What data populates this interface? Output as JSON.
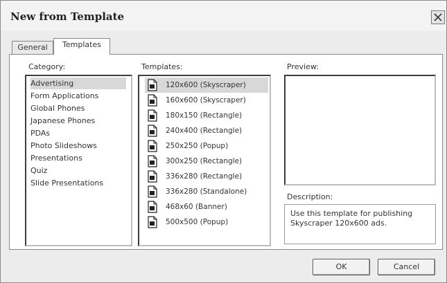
{
  "window": {
    "title": "New from Template"
  },
  "tabs": [
    {
      "label": "General",
      "active": false
    },
    {
      "label": "Templates",
      "active": true
    }
  ],
  "category": {
    "label": "Category:",
    "items": [
      {
        "label": "Advertising",
        "selected": true
      },
      {
        "label": "Form Applications",
        "selected": false
      },
      {
        "label": "Global Phones",
        "selected": false
      },
      {
        "label": "Japanese Phones",
        "selected": false
      },
      {
        "label": "PDAs",
        "selected": false
      },
      {
        "label": "Photo Slideshows",
        "selected": false
      },
      {
        "label": "Presentations",
        "selected": false
      },
      {
        "label": "Quiz",
        "selected": false
      },
      {
        "label": "Slide Presentations",
        "selected": false
      }
    ]
  },
  "templates": {
    "label": "Templates:",
    "items": [
      {
        "label": "120x600 (Skyscraper)",
        "selected": true
      },
      {
        "label": "160x600 (Skyscraper)",
        "selected": false
      },
      {
        "label": "180x150 (Rectangle)",
        "selected": false
      },
      {
        "label": "240x400 (Rectangle)",
        "selected": false
      },
      {
        "label": "250x250 (Popup)",
        "selected": false
      },
      {
        "label": "300x250 (Rectangle)",
        "selected": false
      },
      {
        "label": "336x280 (Rectangle)",
        "selected": false
      },
      {
        "label": "336x280 (Standalone)",
        "selected": false
      },
      {
        "label": "468x60 (Banner)",
        "selected": false
      },
      {
        "label": "500x500 (Popup)",
        "selected": false
      }
    ],
    "item_icon": "document-icon"
  },
  "preview": {
    "label": "Preview:"
  },
  "description": {
    "label": "Description:",
    "text": "Use this template for publishing Skyscraper 120x600 ads."
  },
  "buttons": {
    "ok": "OK",
    "cancel": "Cancel"
  }
}
